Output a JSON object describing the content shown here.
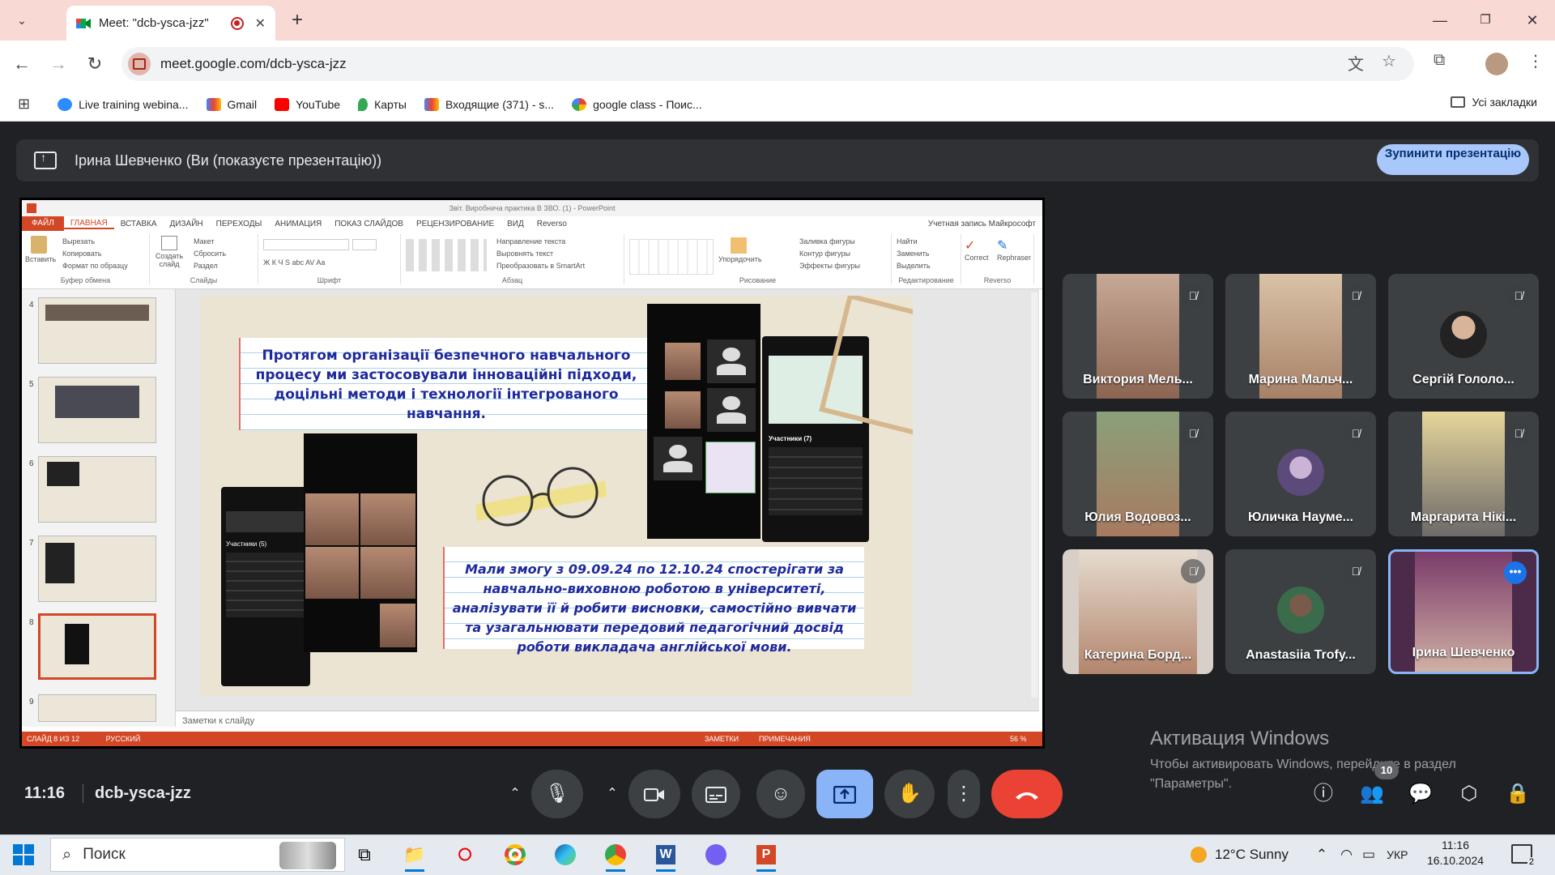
{
  "browser": {
    "tab_title": "Meet: \"dcb-ysca-jzz\"",
    "url": "meet.google.com/dcb-ysca-jzz",
    "bookmarks": [
      {
        "label": "Live training webina...",
        "icon": "zoom-icon",
        "color": "#2d8cff"
      },
      {
        "label": "Gmail",
        "icon": "gmail-icon",
        "color": "#ea4335"
      },
      {
        "label": "YouTube",
        "icon": "youtube-icon",
        "color": "#ff0000"
      },
      {
        "label": "Карты",
        "icon": "maps-icon",
        "color": "#34a853"
      },
      {
        "label": "Входящие (371) - s...",
        "icon": "gmail-icon",
        "color": "#ea4335"
      },
      {
        "label": "google class - Поис...",
        "icon": "google-icon",
        "color": "#4285f4"
      }
    ],
    "all_bookmarks": "Усі закладки"
  },
  "meet": {
    "presenting_banner": "Ірина Шевченко (Ви (показуєте презентацію))",
    "stop_presenting": "Зупинити презентацію",
    "time": "11:16",
    "meeting_code": "dcb-ysca-jzz",
    "people_count": "10",
    "participants": [
      {
        "name": "Виктория Мель...",
        "muted": true,
        "type": "video"
      },
      {
        "name": "Марина Мальч...",
        "muted": true,
        "type": "video"
      },
      {
        "name": "Сергій Гололо...",
        "muted": true,
        "type": "avatar"
      },
      {
        "name": "Юлия Водовоз...",
        "muted": true,
        "type": "video"
      },
      {
        "name": "Юличка Науме...",
        "muted": true,
        "type": "avatar"
      },
      {
        "name": "Маргарита Нікі...",
        "muted": true,
        "type": "video"
      },
      {
        "name": "Катерина Борд...",
        "muted": true,
        "type": "video"
      },
      {
        "name": "Anastasiia Trofy...",
        "muted": true,
        "type": "avatar"
      },
      {
        "name": "Ірина Шевченко",
        "muted": false,
        "type": "video"
      }
    ]
  },
  "windows_activation": {
    "title": "Активация Windows",
    "line1": "Чтобы активировать Windows, перейдите в раздел",
    "line2": "\"Параметры\"."
  },
  "powerpoint": {
    "title": "Звіт. Виробнича практика В ЗВО. (1) - PowerPoint",
    "tabs": [
      "ФАЙЛ",
      "ГЛАВНАЯ",
      "ВСТАВКА",
      "ДИЗАЙН",
      "ПЕРЕХОДЫ",
      "АНИМАЦИЯ",
      "ПОКАЗ СЛАЙДОВ",
      "РЕЦЕНЗИРОВАНИЕ",
      "ВИД",
      "Reverso"
    ],
    "account": "Учетная запись Майкрософт",
    "ribbon_groups": [
      {
        "caption": "Буфер обмена",
        "items": [
          "Вырезать",
          "Копировать",
          "Формат по образцу"
        ],
        "big": "Вставить"
      },
      {
        "caption": "Слайды",
        "items": [
          "Макет",
          "Сбросить",
          "Раздел"
        ],
        "big": "Создать слайд"
      },
      {
        "caption": "Шрифт",
        "items": [
          "",
          "Ж К Ч S abc AV Aa",
          ""
        ]
      },
      {
        "caption": "Абзац",
        "items": [
          "Направление текста",
          "Выровнять текст",
          "Преобразовать в SmartArt"
        ]
      },
      {
        "caption": "Рисование",
        "items": [
          "Заливка фигуры",
          "Контур фигуры",
          "Эффекты фигуры"
        ],
        "big": "Упорядочить"
      },
      {
        "caption": "Редактирование",
        "items": [
          "Найти",
          "Заменить",
          "Выделить"
        ]
      },
      {
        "caption": "Reverso",
        "items": [
          "Correct",
          "Rephraser"
        ]
      }
    ],
    "thumbnail_numbers": [
      "4",
      "5",
      "6",
      "7",
      "8",
      "9"
    ],
    "selected_slide": "8",
    "notes_placeholder": "Заметки к слайду",
    "status_slide": "СЛАЙД 8 ИЗ 12",
    "status_lang": "РУССКИЙ",
    "status_notes": "ЗАМЕТКИ",
    "status_comments": "ПРИМЕЧАНИЯ",
    "zoom": "56 %"
  },
  "slide": {
    "text_top": "Протягом організації безпечного навчального процесу ми застосовували інноваційні підходи, доцільні методи і технології інтегрованого навчання.",
    "text_bottom": "Мали змогу з 09.09.24 по 12.10.24 спостерігати за навчально-виховною роботою в університеті, аналізувати її й робити висновки, самостійно вивчати та узагальнювати передовий педагогічний досвід роботи викладача англійської мови.",
    "zoom_participants_a": "Участники (7)",
    "zoom_participants_b": "Участники (5)"
  },
  "taskbar": {
    "search": "Поиск",
    "weather": "12°C  Sunny",
    "lang": "УКР",
    "time": "11:16",
    "date": "16.10.2024",
    "notif_count": "2"
  }
}
